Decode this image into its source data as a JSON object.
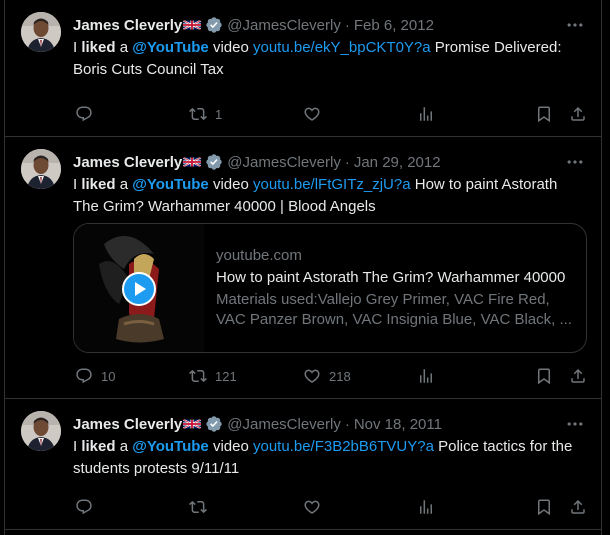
{
  "colors": {
    "background": "#000000",
    "text": "#e7e9ea",
    "muted": "#71767b",
    "link": "#1d9bf0",
    "border": "#2f3336",
    "verified": "#829aab"
  },
  "tweets": [
    {
      "author": {
        "name": "James Cleverly",
        "flag_icon": "uk-flag-icon",
        "verified_icon": "verified-badge-icon",
        "handle": "@JamesCleverly"
      },
      "separator": "·",
      "date": "Feb 6, 2012",
      "text": {
        "prefix": "I ",
        "liked": "liked",
        "a": " a ",
        "mention": "@YouTube",
        "video": " video ",
        "link": "youtu.be/ekY_bpCKT0Y?a",
        "title": " Promise Delivered: Boris Cuts Council Tax"
      },
      "stats": {
        "replies": "",
        "retweets": "1",
        "likes": "",
        "views": ""
      }
    },
    {
      "author": {
        "name": "James Cleverly",
        "flag_icon": "uk-flag-icon",
        "verified_icon": "verified-badge-icon",
        "handle": "@JamesCleverly"
      },
      "separator": "·",
      "date": "Jan 29, 2012",
      "text": {
        "prefix": "I ",
        "liked": "liked",
        "a": " a ",
        "mention": "@YouTube",
        "video": " video ",
        "link": "youtu.be/lFtGITz_zjU?a",
        "title": " How to paint Astorath The Grim? Warhammer 40000 | Blood Angels"
      },
      "card": {
        "domain": "youtube.com",
        "title": "How to paint Astorath The Grim? Warhammer 40000",
        "description": "Materials used:Vallejo Grey Primer, VAC Fire Red, VAC Panzer Brown, VAC Insignia Blue, VAC Black, ...",
        "play_icon": "play-icon"
      },
      "stats": {
        "replies": "10",
        "retweets": "121",
        "likes": "218",
        "views": ""
      }
    },
    {
      "author": {
        "name": "James Cleverly",
        "flag_icon": "uk-flag-icon",
        "verified_icon": "verified-badge-icon",
        "handle": "@JamesCleverly"
      },
      "separator": "·",
      "date": "Nov 18, 2011",
      "text": {
        "prefix": "I ",
        "liked": "liked",
        "a": " a ",
        "mention": "@YouTube",
        "video": " video ",
        "link": "youtu.be/F3B2bB6TVUY?a",
        "title": " Police tactics for the students protests 9/11/11"
      },
      "stats": {
        "replies": "",
        "retweets": "",
        "likes": "",
        "views": ""
      }
    }
  ],
  "icons": {
    "reply": "reply-icon",
    "retweet": "retweet-icon",
    "like": "heart-icon",
    "views": "views-icon",
    "bookmark": "bookmark-icon",
    "share": "share-icon",
    "more": "more-icon"
  }
}
